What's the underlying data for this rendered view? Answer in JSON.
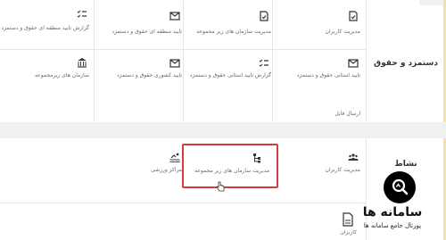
{
  "sections": {
    "salary": {
      "title": "دستمزد و حقوق",
      "tiles": [
        {
          "label": "مدیریت کاربران",
          "icon": "document-check-icon"
        },
        {
          "label": "مدیریت سازمان های زیر مجموعه",
          "icon": "document-check-icon"
        },
        {
          "label": "تایید منطقه ای حقوق و دستمزد",
          "icon": "envelope-icon"
        },
        {
          "label": "گزارش تایید منطقه ای حقوق و دستمزد",
          "icon": "checklist-icon"
        },
        {
          "label": "تایید استانی حقوق و دستمزد",
          "icon": "envelope-icon"
        },
        {
          "label": "گزارش تایید استانی حقوق و دستمزد",
          "icon": "checklist-icon"
        },
        {
          "label": "تایید کشوری حقوق و دستمزد",
          "icon": "envelope-icon"
        },
        {
          "label": "سازمان های زیرمجموعه",
          "icon": "bank-icon"
        },
        {
          "label": "ارسال فایل",
          "icon": "none"
        }
      ]
    },
    "activity": {
      "title": "نشاط",
      "tiles": [
        {
          "label": "مدیریت کاربران",
          "icon": "users-icon"
        },
        {
          "label": "مدیریت سازمان های زیر مجموعه",
          "icon": "hierarchy-icon"
        },
        {
          "label": "مراکز ورزشی",
          "icon": "swimming-icon"
        }
      ],
      "footer_tile": {
        "label": "کاربران",
        "icon": "document-icon"
      }
    }
  },
  "brand": {
    "name": "سامانه ها",
    "tagline": "پورتال جامع سامانه ها",
    "icon": "magnifier-icon"
  },
  "colors": {
    "highlight": "#d73a3a",
    "accent": "#f3e3a0",
    "gap": "#f1f1f1"
  }
}
